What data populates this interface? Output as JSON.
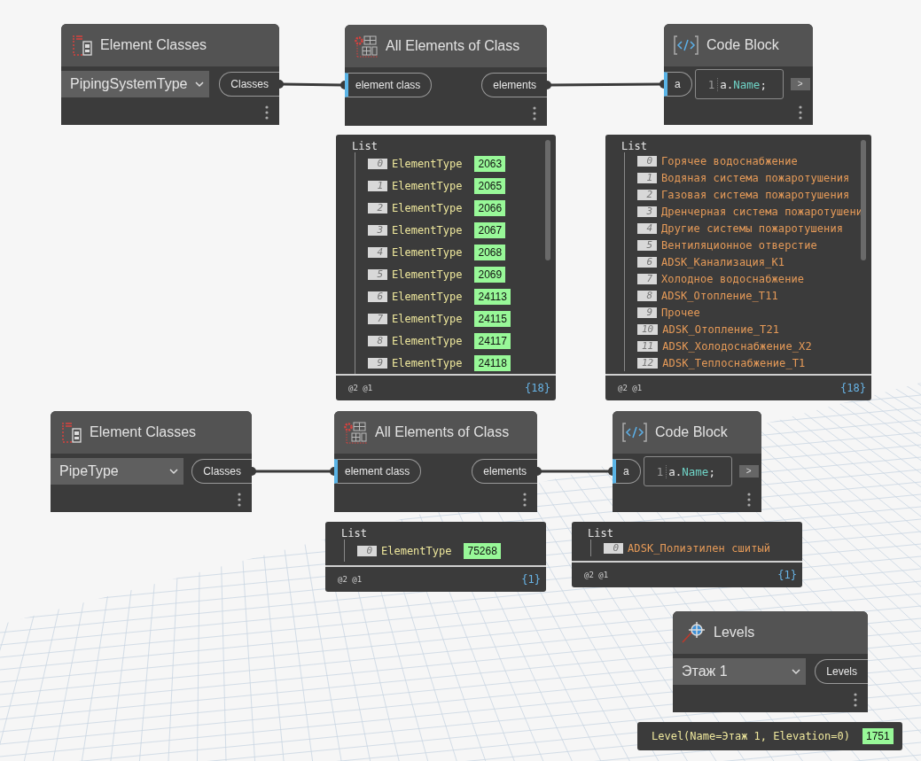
{
  "nodes": [
    {
      "kind": "element_classes",
      "title": "Element Classes",
      "dropdown": "PipingSystemType",
      "outputs": [
        "Classes"
      ]
    },
    {
      "kind": "all_elements",
      "title": "All Elements of Class",
      "inputs": [
        "element class"
      ],
      "outputs": [
        "elements"
      ],
      "preview": {
        "kind": "list",
        "title": "List",
        "items": [
          {
            "index": "0",
            "type": "ElementType",
            "id": "2063"
          },
          {
            "index": "1",
            "type": "ElementType",
            "id": "2065"
          },
          {
            "index": "2",
            "type": "ElementType",
            "id": "2066"
          },
          {
            "index": "3",
            "type": "ElementType",
            "id": "2067"
          },
          {
            "index": "4",
            "type": "ElementType",
            "id": "2068"
          },
          {
            "index": "5",
            "type": "ElementType",
            "id": "2069"
          },
          {
            "index": "6",
            "type": "ElementType",
            "id": "24113"
          },
          {
            "index": "7",
            "type": "ElementType",
            "id": "24115"
          },
          {
            "index": "8",
            "type": "ElementType",
            "id": "24117"
          },
          {
            "index": "9",
            "type": "ElementType",
            "id": "24118"
          }
        ],
        "levels": "@2 @1",
        "count": "{18}"
      }
    },
    {
      "kind": "code_block",
      "title": "Code Block",
      "inputs": [
        "a"
      ],
      "line_number": "1",
      "code": [
        {
          "text": "a.",
          "kind": "plain"
        },
        {
          "text": "Name",
          "kind": "member"
        },
        {
          "text": ";",
          "kind": "plain"
        }
      ],
      "expand": ">",
      "preview": {
        "kind": "list",
        "title": "List",
        "items": [
          {
            "index": "0",
            "value": "Горячее водоснабжение"
          },
          {
            "index": "1",
            "value": "Водяная система пожаротушения"
          },
          {
            "index": "2",
            "value": "Газовая система пожаротушения"
          },
          {
            "index": "3",
            "value": "Дренчерная система пожаротушени"
          },
          {
            "index": "4",
            "value": "Другие системы пожаротушения"
          },
          {
            "index": "5",
            "value": "Вентиляционное отверстие"
          },
          {
            "index": "6",
            "value": "ADSK_Канализация_К1"
          },
          {
            "index": "7",
            "value": "Холодное водоснабжение"
          },
          {
            "index": "8",
            "value": "ADSK_Отопление_Т11"
          },
          {
            "index": "9",
            "value": "Прочее"
          },
          {
            "index": "10",
            "value": "ADSK_Отопление_Т21"
          },
          {
            "index": "11",
            "value": "ADSK_Холодоснабжение_Х2"
          },
          {
            "index": "12",
            "value": "ADSK_Теплоснабжение_Т1"
          }
        ],
        "levels": "@2 @1",
        "count": "{18}"
      }
    },
    {
      "kind": "element_classes",
      "title": "Element Classes",
      "dropdown": "PipeType",
      "outputs": [
        "Classes"
      ]
    },
    {
      "kind": "all_elements",
      "title": "All Elements of Class",
      "inputs": [
        "element class"
      ],
      "outputs": [
        "elements"
      ],
      "preview": {
        "kind": "list",
        "title": "List",
        "items": [
          {
            "index": "0",
            "type": "ElementType",
            "id": "75268"
          }
        ],
        "levels": "@2 @1",
        "count": "{1}"
      }
    },
    {
      "kind": "code_block",
      "title": "Code Block",
      "inputs": [
        "a"
      ],
      "line_number": "1",
      "code": [
        {
          "text": "a.",
          "kind": "plain"
        },
        {
          "text": "Name",
          "kind": "member"
        },
        {
          "text": ";",
          "kind": "plain"
        }
      ],
      "expand": ">",
      "preview": {
        "kind": "list",
        "title": "List",
        "items": [
          {
            "index": "0",
            "value": "ADSK_Полиэтилен сшитый"
          }
        ],
        "levels": "@2 @1",
        "count": "{1}"
      }
    },
    {
      "kind": "levels",
      "title": "Levels",
      "dropdown": "Этаж 1",
      "outputs": [
        "Levels"
      ],
      "preview": {
        "kind": "single",
        "value": "Level(Name=Этаж 1, Elevation=0)",
        "id": "1751"
      }
    }
  ]
}
